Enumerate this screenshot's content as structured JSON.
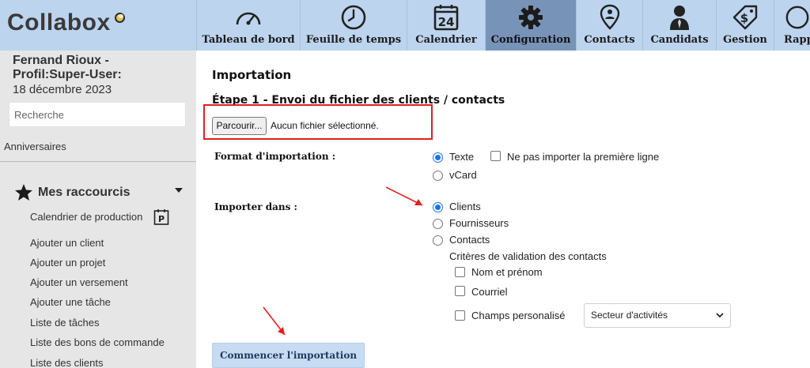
{
  "app": {
    "name": "Collabox"
  },
  "nav": {
    "tabs": [
      {
        "label": "Tableau de bord",
        "icon": "speedometer-icon"
      },
      {
        "label": "Feuille de temps",
        "icon": "clock-icon"
      },
      {
        "label": "Calendrier",
        "icon": "calendar-icon",
        "icon_text": "24"
      },
      {
        "label": "Configuration",
        "icon": "gear-icon",
        "active": true
      },
      {
        "label": "Contacts",
        "icon": "location-pin-icon"
      },
      {
        "label": "Candidats",
        "icon": "person-icon"
      },
      {
        "label": "Gestion",
        "icon": "dollar-tag-icon"
      },
      {
        "label": "Rapp",
        "icon": "reports-icon"
      }
    ]
  },
  "sidebar": {
    "user_line1": "Fernand Rioux -",
    "user_line2": "Profil:Super-User:",
    "date": "18 décembre 2023",
    "search_placeholder": "Recherche",
    "birthdays": "Anniversaires",
    "shortcuts_title": "Mes raccourcis",
    "shortcut_badge": "P",
    "shortcuts": [
      "Calendrier de production",
      "Ajouter un client",
      "Ajouter un projet",
      "Ajouter un versement",
      "Ajouter une tâche",
      "Liste de tâches",
      "Liste des bons de commande",
      "Liste des clients"
    ]
  },
  "main": {
    "title": "Importation",
    "step_title": "Étape 1 - Envoi du fichier des clients / contacts",
    "browse_label": "Parcourir...",
    "no_file_label": "Aucun fichier sélectionné.",
    "format_label": "Format d'importation :",
    "format_options": [
      "Texte",
      "vCard"
    ],
    "format_selected": "Texte",
    "skip_first_line_label": "Ne pas importer la première ligne",
    "import_into_label": "Importer dans :",
    "import_options": [
      "Clients",
      "Fournisseurs",
      "Contacts"
    ],
    "import_selected": "Clients",
    "validation_title": "Critères de validation des contacts",
    "validation_options": [
      "Nom et prénom",
      "Courriel",
      "Champs personalisé"
    ],
    "custom_field_value": "Secteur d'activités",
    "start_button": "Commencer l'importation"
  },
  "colors": {
    "topbar": "#bcd4ee",
    "active_tab": "#7893b8",
    "sidebar": "#e6e6e6",
    "accent": "#1a73e8",
    "highlight": "#e02020",
    "start_button": "#c7dcf3"
  }
}
